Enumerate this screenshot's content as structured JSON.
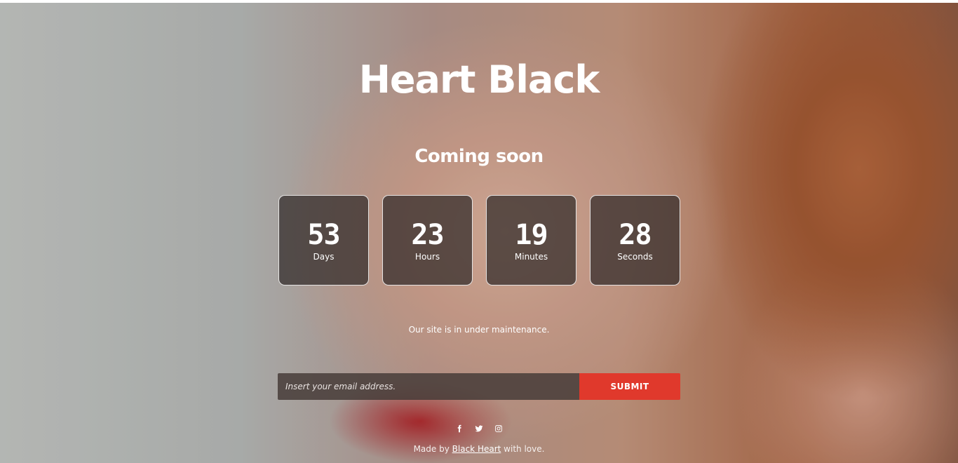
{
  "header": {
    "title": "Heart Black"
  },
  "hero": {
    "subtitle": "Coming soon"
  },
  "countdown": [
    {
      "value": "53",
      "unit": "Days"
    },
    {
      "value": "23",
      "unit": "Hours"
    },
    {
      "value": "19",
      "unit": "Minutes"
    },
    {
      "value": "28",
      "unit": "Seconds"
    }
  ],
  "notice": "Our site is in under maintenance.",
  "subscribe": {
    "placeholder": "Insert your email address.",
    "submit_label": "SUBMIT"
  },
  "social": [
    "facebook-icon",
    "twitter-icon",
    "instagram-icon"
  ],
  "footer": {
    "prefix": "Made by",
    "link_text": "Black Heart",
    "suffix": "with love."
  },
  "colors": {
    "accent": "#e0392c",
    "box_bg": "#302a28"
  }
}
